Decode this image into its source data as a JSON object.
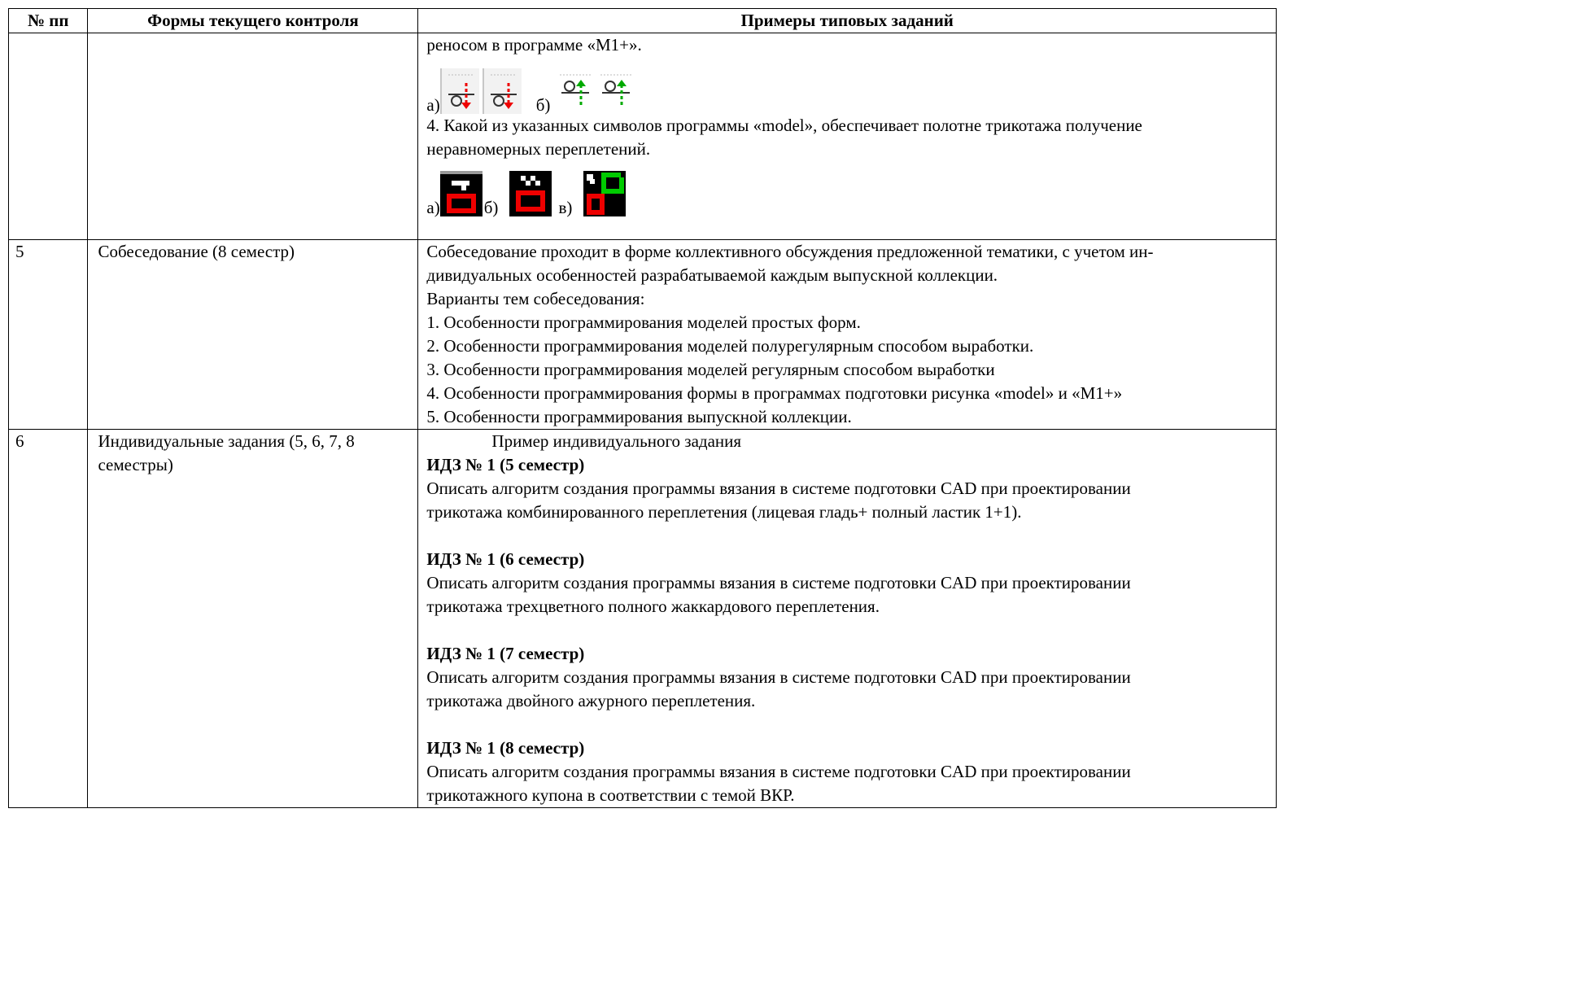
{
  "table": {
    "headers": [
      "№ пп",
      "Формы текущего контроля",
      "Примеры типовых заданий"
    ],
    "row_cont": {
      "line1": "реносом в программе «M1+».",
      "icons_a_label": "а)",
      "icons_b_label": "б)",
      "q4_line1": "4. Какой из указанных символов программы «model», обеспечивает полотне трикотажа получение",
      "q4_line2": "неравномерных переплетений.",
      "sym_a_label": "а)",
      "sym_b_label": "б)",
      "sym_c_label": "в)"
    },
    "row5": {
      "num": "5",
      "form": "Собеседование (8 семестр)",
      "line1": "Собеседование проходит в форме коллективного обсуждения предложенной тематики, с учетом ин-",
      "line2": "дивидуальных особенностей разрабатываемой каждым выпускной коллекции.",
      "line3": "Варианты тем собеседования:",
      "topics": [
        "1. Особенности программирования моделей простых форм.",
        "2. Особенности программирования моделей полурегулярным способом выработки.",
        "3. Особенности программирования моделей регулярным способом выработки",
        "4. Особенности программирования формы в программах подготовки рисунка «model» и «M1+»",
        "5. Особенности программирования выпускной коллекции."
      ]
    },
    "row6": {
      "num": "6",
      "form_line1": "Индивидуальные задания (5, 6, 7, 8",
      "form_line2": "семестры)",
      "intro": "Пример индивидуального задания",
      "tasks": [
        {
          "title": "ИДЗ № 1 (5 семестр)",
          "line1": "Описать алгоритм создания программы вязания в системе подготовки CAD при проектировании",
          "line2": "трикотажа комбинированного переплетения (лицевая гладь+ полный ластик 1+1)."
        },
        {
          "title": "ИДЗ № 1 (6 семестр)",
          "line1": "Описать алгоритм создания программы вязания в системе подготовки CAD при проектировании",
          "line2": "трикотажа трехцветного полного жаккардового переплетения."
        },
        {
          "title": "ИДЗ № 1 (7 семестр)",
          "line1": "Описать алгоритм создания программы вязания в системе подготовки CAD при проектировании",
          "line2": "трикотажа двойного ажурного переплетения."
        },
        {
          "title": "ИДЗ № 1 (8 семестр)",
          "line1": "Описать алгоритм создания программы вязания в системе подготовки CAD при проектировании",
          "line2": "трикотажного купона в соответствии с темой ВКР."
        }
      ]
    }
  }
}
